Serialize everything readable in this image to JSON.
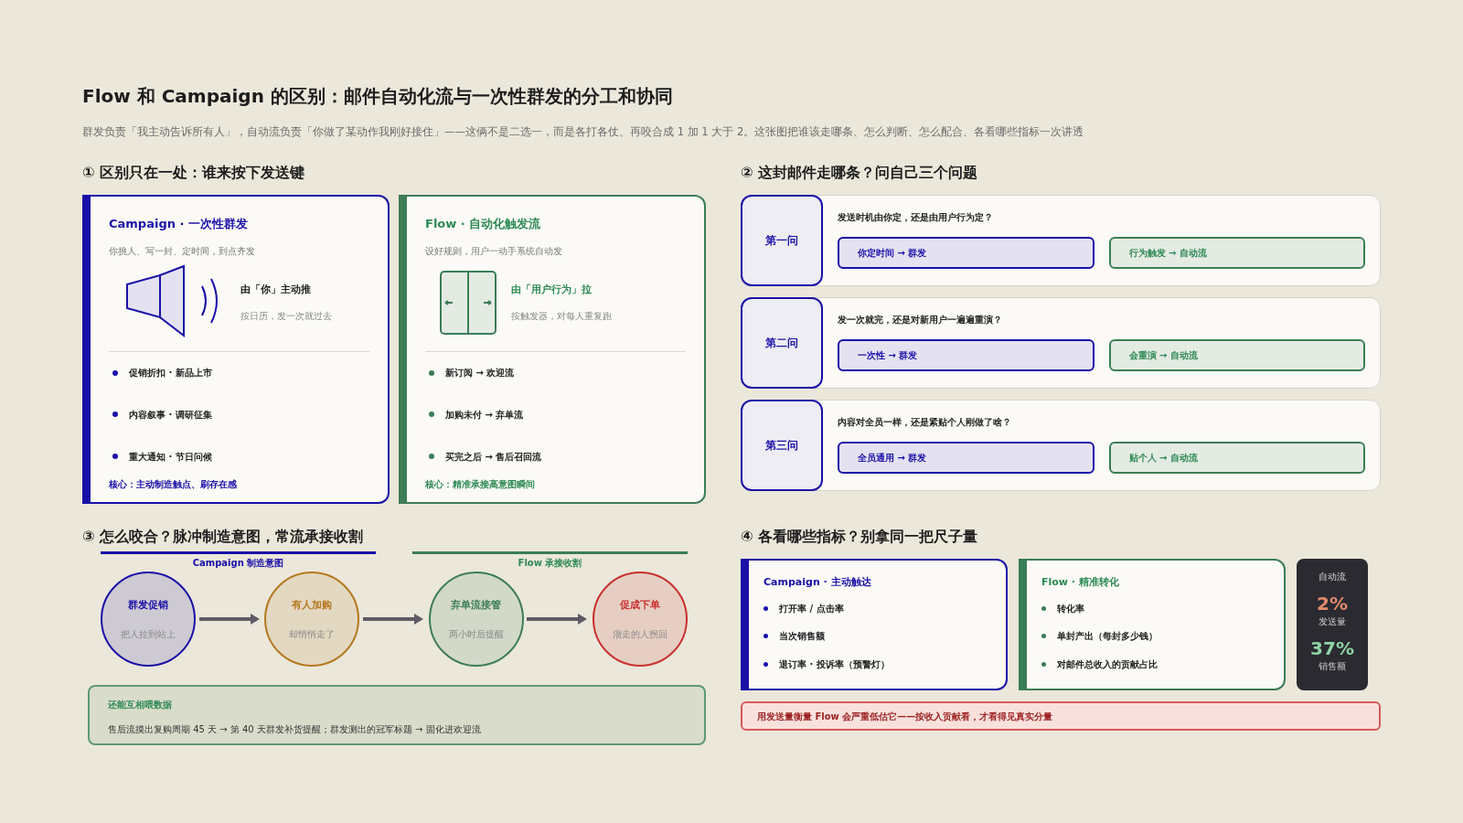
{
  "title": "Flow 和 Campaign 的区别：邮件自动化流与一次性群发的分工和协同",
  "subtitle": "群发负责「我主动告诉所有人」，自动流负责「你做了某动作我刚好接住」——这俩不是二选一，而是各打各仗、再咬合成 1 加 1 大于 2。这张图把谁该走哪条、怎么判断、怎么配合、各看哪些指标一次讲透",
  "section1": {
    "heading": "① 区别只在一处：谁来按下发送键",
    "cards": [
      {
        "kind": "campaign",
        "title": "Campaign · 一次性群发",
        "description": "你挑人、写一封、定时间，到点齐发",
        "mode_title": "由「你」主动推",
        "mode_note": "按日历，发一次就过去",
        "items": [
          "促销折扣 · 新品上市",
          "内容叙事 · 调研征集",
          "重大通知 · 节日问候"
        ],
        "core": "核心：主动制造触点、刷存在感"
      },
      {
        "kind": "flow",
        "title": "Flow · 自动化触发流",
        "description": "设好规则，用户一动手系统自动发",
        "mode_title": "由「用户行为」拉",
        "mode_note": "按触发器，对每人重复跑",
        "items": [
          "新订阅 → 欢迎流",
          "加购未付 → 弃单流",
          "买完之后 → 售后召回流"
        ],
        "core": "核心：精准承接高意图瞬间"
      }
    ]
  },
  "section2": {
    "heading": "② 这封邮件走哪条？问自己三个问题",
    "questions": [
      {
        "label": "第一问",
        "question": "发送时机由你定，还是由用户行为定？",
        "campaign_answer": "你定时间 → 群发",
        "flow_answer": "行为触发 → 自动流"
      },
      {
        "label": "第二问",
        "question": "发一次就完，还是对新用户一遍遍重演？",
        "campaign_answer": "一次性 → 群发",
        "flow_answer": "会重演 → 自动流"
      },
      {
        "label": "第三问",
        "question": "内容对全员一样，还是紧贴个人刚做了啥？",
        "campaign_answer": "全员通用 → 群发",
        "flow_answer": "贴个人 → 自动流"
      }
    ]
  },
  "section3": {
    "heading": "③ 怎么咬合？脉冲制造意图，常流承接收割",
    "phases": [
      {
        "kind": "campaign",
        "label": "Campaign 制造意图"
      },
      {
        "kind": "flow",
        "label": "Flow 承接收割"
      }
    ],
    "steps": [
      {
        "title": "群发促销",
        "note": "把人拉到站上",
        "color": "#1a10a8"
      },
      {
        "title": "有人加购",
        "note": "却悄悄走了",
        "color": "#b5781e"
      },
      {
        "title": "弃单流接管",
        "note": "两小时后提醒",
        "color": "#3b7d57"
      },
      {
        "title": "促成下单",
        "note": "溜走的人拐回",
        "color": "#c8302e"
      }
    ],
    "feedback": {
      "title": "还能互相喂数据",
      "text": "售后流摸出复购周期 45 天 → 第 40 天群发补货提醒；群发测出的冠军标题 → 固化进欢迎流"
    }
  },
  "section4": {
    "heading": "④ 各看哪些指标？别拿同一把尺子量",
    "cards": [
      {
        "kind": "campaign",
        "title": "Campaign · 主动触达",
        "items": [
          "打开率 / 点击率",
          "当次销售额",
          "退订率 · 投诉率（预警灯）"
        ]
      },
      {
        "kind": "flow",
        "title": "Flow · 精准转化",
        "items": [
          "转化率",
          "单封产出（每封多少钱）",
          "对邮件总收入的贡献占比"
        ]
      }
    ],
    "stats": {
      "title": "自动流",
      "metrics": [
        {
          "value": "2%",
          "label": "发送量",
          "color": "#e08a6c"
        },
        {
          "value": "37%",
          "label": "销售额",
          "color": "#8ed4a6"
        }
      ]
    },
    "warning": "用发送量衡量 Flow 会严重低估它——按收入贡献看，才看得见真实分量"
  }
}
